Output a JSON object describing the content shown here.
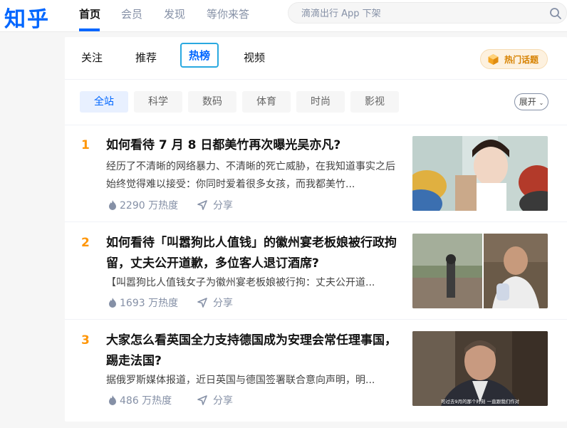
{
  "header": {
    "logo": "知乎",
    "nav": [
      {
        "label": "首页",
        "active": true
      },
      {
        "label": "会员",
        "active": false
      },
      {
        "label": "发现",
        "active": false
      },
      {
        "label": "等你来答",
        "active": false
      }
    ],
    "search": {
      "placeholder": "滴滴出行 App 下架",
      "icon": "search-icon"
    }
  },
  "tabs": [
    {
      "label": "关注"
    },
    {
      "label": "推荐"
    },
    {
      "label": "热榜",
      "active": true
    },
    {
      "label": "视频"
    }
  ],
  "hot_topic_button": {
    "label": "热门话题",
    "icon": "hot-topic-icon"
  },
  "filters": [
    {
      "label": "全站",
      "active": true
    },
    {
      "label": "科学"
    },
    {
      "label": "数码"
    },
    {
      "label": "体育"
    },
    {
      "label": "时尚"
    },
    {
      "label": "影视"
    }
  ],
  "expand_label": "展开",
  "items": [
    {
      "rank": "1",
      "title": "如何看待 7 月 8 日都美竹再次曝光吴亦凡?",
      "excerpt": "经历了不清晰的网络暴力、不清晰的死亡威胁，在我知道事实之后始终觉得难以接受：你同时爱着很多女孩，而我都美竹...",
      "heat": "2290 万热度",
      "share": "分享"
    },
    {
      "rank": "2",
      "title": "如何看待「叫嚣狗比人值钱」的徽州宴老板娘被行政拘留，丈夫公开道歉，多位客人退订酒席?",
      "excerpt": "【叫嚣狗比人值钱女子为徽州宴老板娘被行拘：丈夫公开道...",
      "heat": "1693 万热度",
      "share": "分享"
    },
    {
      "rank": "3",
      "title": "大家怎么看英国全力支持德国成为安理会常任理事国，踢走法国?",
      "excerpt": "据俄罗斯媒体报道，近日英国与德国签署联合意向声明，明...",
      "heat": "486 万热度",
      "share": "分享",
      "thumb_caption": "可过去9月的那个时刻 一直跟我们作对"
    }
  ],
  "colors": {
    "brand": "#0066ff",
    "rank": "#ff9607",
    "muted": "#8590a6"
  }
}
